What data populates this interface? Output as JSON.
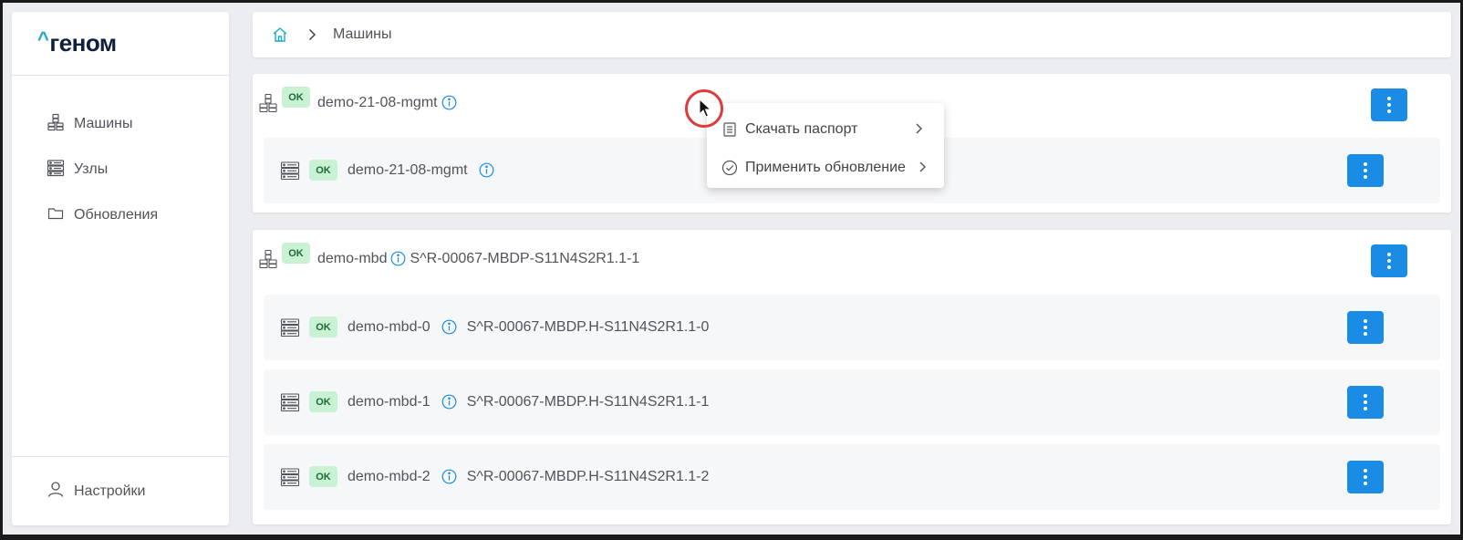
{
  "app": {
    "logo_caret": "^",
    "logo_text": "геном"
  },
  "sidebar": {
    "items": [
      {
        "label": "Машины",
        "icon": "machines-icon"
      },
      {
        "label": "Узлы",
        "icon": "nodes-icon"
      },
      {
        "label": "Обновления",
        "icon": "folder-icon"
      }
    ],
    "settings_label": "Настройки"
  },
  "breadcrumb": {
    "current": "Машины"
  },
  "machines": [
    {
      "status": "OK",
      "name": "demo-21-08-mgmt",
      "serial": "",
      "nodes": [
        {
          "status": "OK",
          "name": "demo-21-08-mgmt",
          "serial": ""
        }
      ]
    },
    {
      "status": "OK",
      "name": "demo-mbd",
      "serial": "S^R-00067-MBDP-S11N4S2R1.1-1",
      "nodes": [
        {
          "status": "OK",
          "name": "demo-mbd-0",
          "serial": "S^R-00067-MBDP.H-S11N4S2R1.1-0"
        },
        {
          "status": "OK",
          "name": "demo-mbd-1",
          "serial": "S^R-00067-MBDP.H-S11N4S2R1.1-1"
        },
        {
          "status": "OK",
          "name": "demo-mbd-2",
          "serial": "S^R-00067-MBDP.H-S11N4S2R1.1-2"
        }
      ]
    }
  ],
  "context_menu": {
    "items": [
      {
        "label": "Скачать паспорт",
        "icon": "document-icon"
      },
      {
        "label": "Применить обновление",
        "icon": "check-circle-icon"
      }
    ]
  },
  "colors": {
    "accent": "#1a8ce6",
    "badge_bg": "#c9f2d4",
    "badge_text": "#1d6b36",
    "logo_accent": "#1aa9c9",
    "cursor_ring": "#e03a3a"
  }
}
